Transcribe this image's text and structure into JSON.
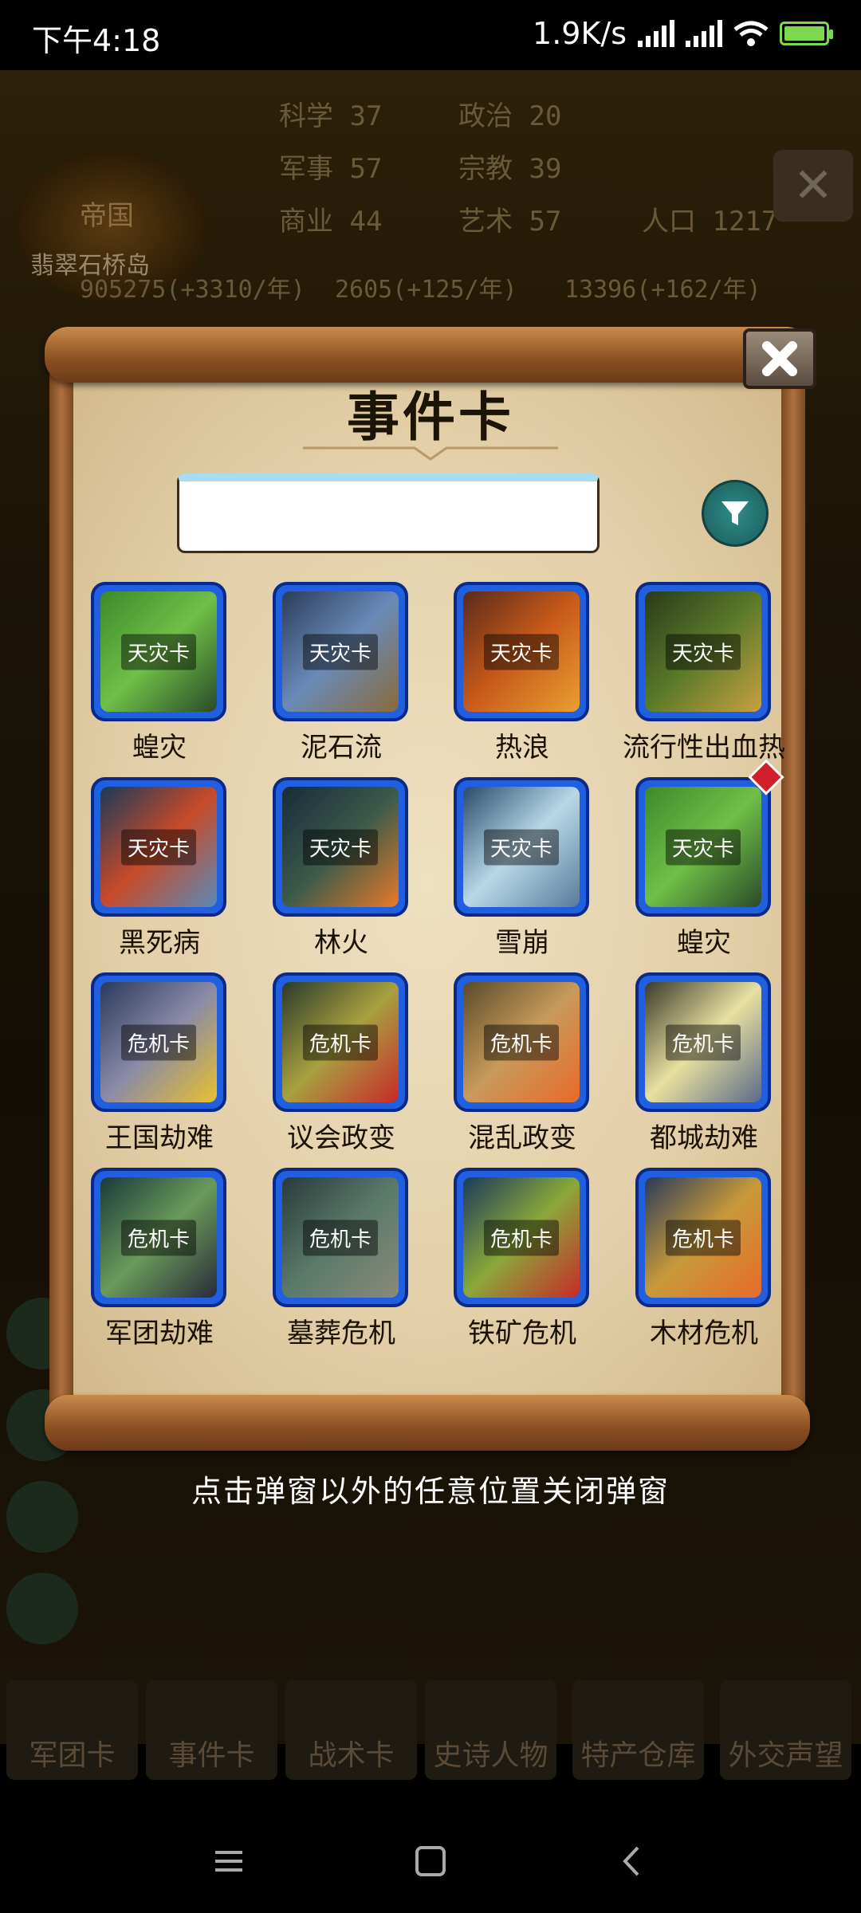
{
  "status_bar": {
    "time": "下午4:18",
    "net_speed": "1.9K/s"
  },
  "background": {
    "kingdom_type": "帝国",
    "kingdom_name": "翡翠石桥岛",
    "stats": [
      {
        "label": "科学",
        "value": "37"
      },
      {
        "label": "政治",
        "value": "20"
      },
      {
        "label": "军事",
        "value": "57"
      },
      {
        "label": "宗教",
        "value": "39"
      },
      {
        "label": "商业",
        "value": "44"
      },
      {
        "label": "艺术",
        "value": "57"
      },
      {
        "label": "人口",
        "value": "1217"
      }
    ],
    "resources": [
      "905275(+3310/年)",
      "2605(+125/年)",
      "13396(+162/年)"
    ],
    "bottom_tabs": [
      "军团卡",
      "事件卡",
      "战术卡",
      "史诗人物",
      "特产仓库",
      "外交声望"
    ]
  },
  "modal": {
    "title": "事件卡",
    "search_placeholder": "",
    "cards": [
      {
        "name": "蝗灾",
        "badge": "天灾卡",
        "theme": [
          "#3d8a2a",
          "#6fbf48",
          "#2a4a2a"
        ],
        "gem": false
      },
      {
        "name": "泥石流",
        "badge": "天灾卡",
        "theme": [
          "#2a3d5a",
          "#6a8ab8",
          "#8a6a3a"
        ],
        "gem": false
      },
      {
        "name": "热浪",
        "badge": "天灾卡",
        "theme": [
          "#5a2a1a",
          "#c85a1a",
          "#e8a030"
        ],
        "gem": false
      },
      {
        "name": "流行性出血热",
        "badge": "天灾卡",
        "theme": [
          "#2a3a1a",
          "#5a7a2a",
          "#c8a040"
        ],
        "gem": false
      },
      {
        "name": "黑死病",
        "badge": "天灾卡",
        "theme": [
          "#1a3a5a",
          "#c84a2a",
          "#5a8ab8"
        ],
        "gem": false
      },
      {
        "name": "林火",
        "badge": "天灾卡",
        "theme": [
          "#1a2a3a",
          "#3a5a4a",
          "#e87a2a"
        ],
        "gem": false
      },
      {
        "name": "雪崩",
        "badge": "天灾卡",
        "theme": [
          "#2a4a6a",
          "#b8d8e8",
          "#5a7a9a"
        ],
        "gem": false
      },
      {
        "name": "蝗灾",
        "badge": "天灾卡",
        "theme": [
          "#3d8a2a",
          "#6fbf48",
          "#2a4a2a"
        ],
        "gem": true
      },
      {
        "name": "王国劫难",
        "badge": "危机卡",
        "theme": [
          "#2a3a5a",
          "#8a8aa8",
          "#e8c030"
        ],
        "gem": false
      },
      {
        "name": "议会政变",
        "badge": "危机卡",
        "theme": [
          "#2a3a2a",
          "#a8a040",
          "#c82a2a"
        ],
        "gem": false
      },
      {
        "name": "混乱政变",
        "badge": "危机卡",
        "theme": [
          "#5a4a2a",
          "#c89a5a",
          "#e86a2a"
        ],
        "gem": false
      },
      {
        "name": "都城劫难",
        "badge": "危机卡",
        "theme": [
          "#3a3a2a",
          "#e8e0a0",
          "#5a6a8a"
        ],
        "gem": false
      },
      {
        "name": "军团劫难",
        "badge": "危机卡",
        "theme": [
          "#1a3a3a",
          "#6a9a5a",
          "#2a2a3a"
        ],
        "gem": false
      },
      {
        "name": "墓葬危机",
        "badge": "危机卡",
        "theme": [
          "#2a3a3a",
          "#5a7a6a",
          "#8a8a7a"
        ],
        "gem": false
      },
      {
        "name": "铁矿危机",
        "badge": "危机卡",
        "theme": [
          "#1a3a5a",
          "#8aa83a",
          "#c82a2a"
        ],
        "gem": false
      },
      {
        "name": "木材危机",
        "badge": "危机卡",
        "theme": [
          "#2a3a5a",
          "#c89a3a",
          "#e86a2a"
        ],
        "gem": false
      }
    ]
  },
  "hint": "点击弹窗以外的任意位置关闭弹窗"
}
